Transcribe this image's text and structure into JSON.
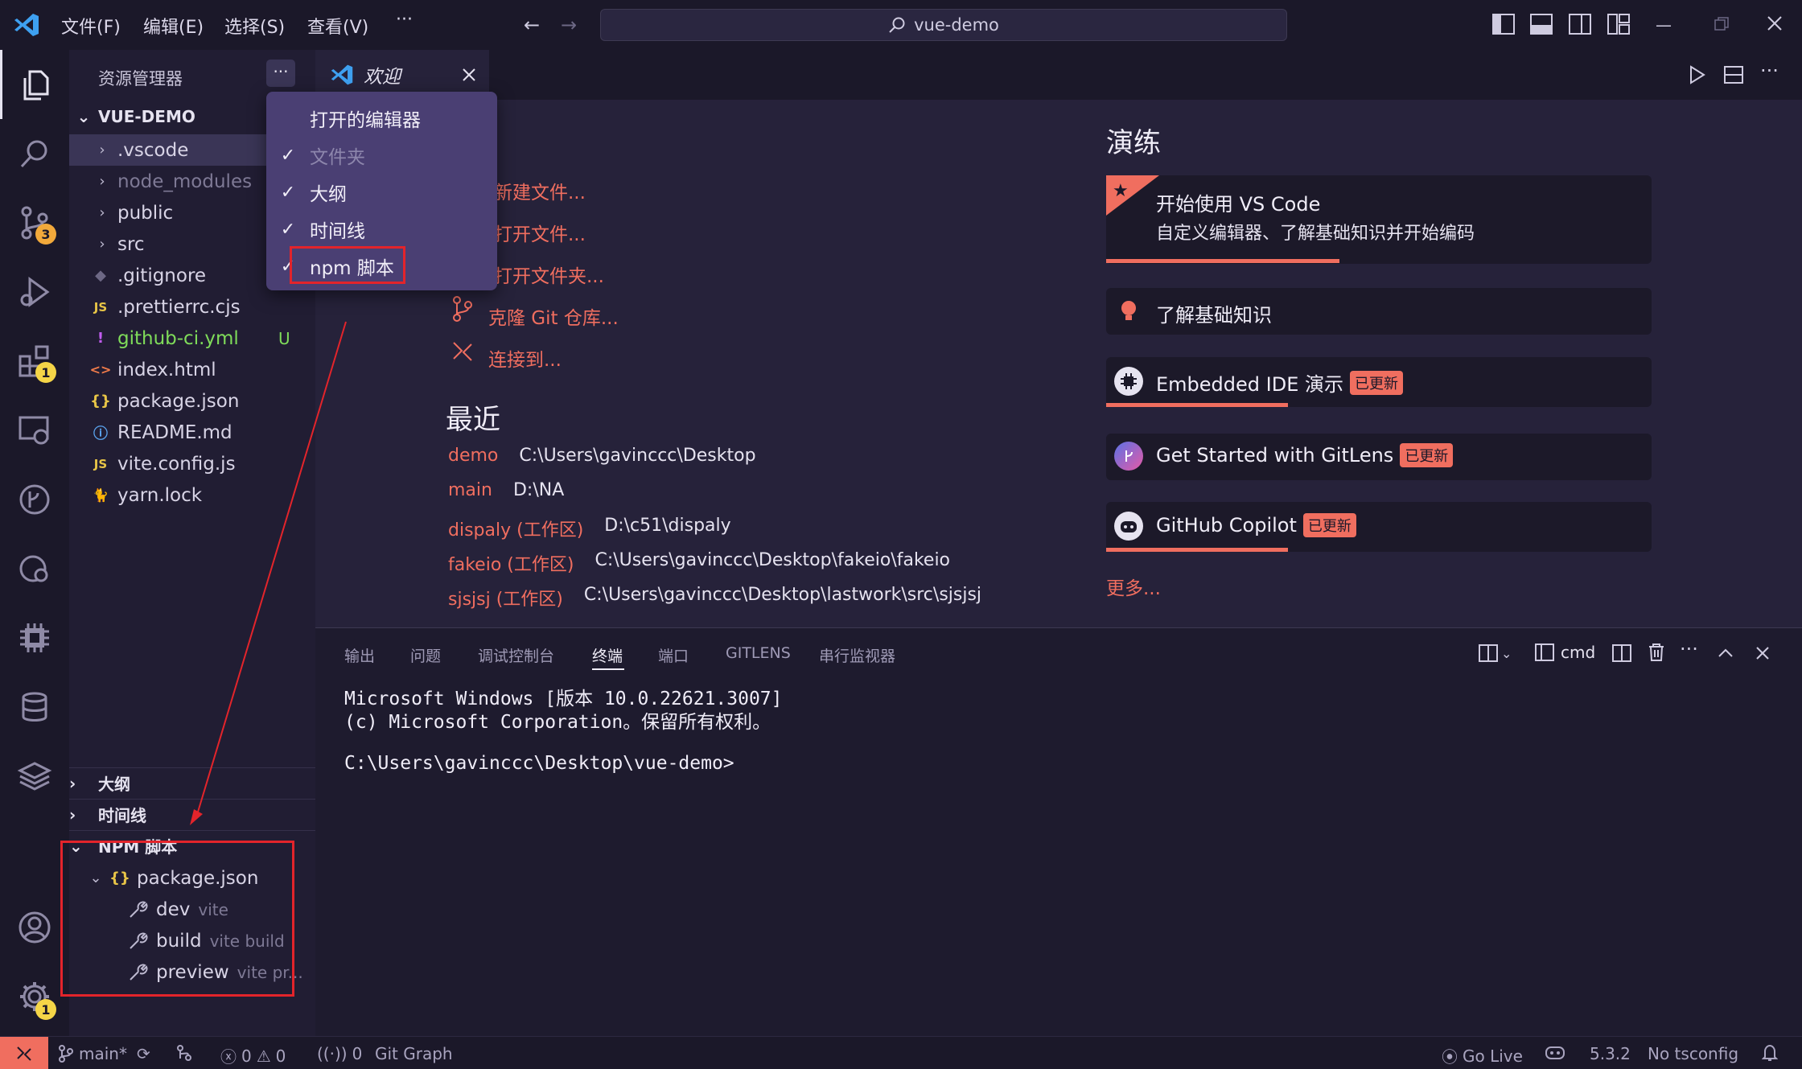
{
  "titlebar": {
    "menus": [
      "文件(F)",
      "编辑(E)",
      "选择(S)",
      "查看(V)"
    ],
    "more": "···",
    "search": "vue-demo"
  },
  "activity": {
    "scm_badge": "3",
    "extensions_badge": "1",
    "settings_badge": "1"
  },
  "sidebar": {
    "title": "资源管理器",
    "more": "···",
    "root": "VUE-DEMO",
    "items": [
      {
        "label": ".vscode",
        "type": "folder"
      },
      {
        "label": "node_modules",
        "type": "folder"
      },
      {
        "label": "public",
        "type": "folder"
      },
      {
        "label": "src",
        "type": "folder"
      },
      {
        "label": ".gitignore",
        "type": "file",
        "icon": "◆"
      },
      {
        "label": ".prettierrc.cjs",
        "type": "file",
        "icon": "JS"
      },
      {
        "label": "github-ci.yml",
        "type": "file",
        "icon": "!",
        "status": "U"
      },
      {
        "label": "index.html",
        "type": "file",
        "icon": "<>"
      },
      {
        "label": "package.json",
        "type": "file",
        "icon": "{}"
      },
      {
        "label": "README.md",
        "type": "file",
        "icon": "ⓘ"
      },
      {
        "label": "vite.config.js",
        "type": "file",
        "icon": "JS"
      },
      {
        "label": "yarn.lock",
        "type": "file",
        "icon": "🐈"
      }
    ],
    "outline": "大纲",
    "timeline": "时间线",
    "npm": {
      "header": "NPM 脚本",
      "package": "package.json",
      "scripts": [
        {
          "name": "dev",
          "cmd": "vite"
        },
        {
          "name": "build",
          "cmd": "vite build"
        },
        {
          "name": "preview",
          "cmd": "vite pr..."
        }
      ]
    }
  },
  "context_menu": {
    "items": [
      {
        "label": "打开的编辑器",
        "checked": false,
        "dim": false
      },
      {
        "label": "文件夹",
        "checked": true,
        "dim": true
      },
      {
        "label": "大纲",
        "checked": true,
        "dim": false
      },
      {
        "label": "时间线",
        "checked": true,
        "dim": false
      },
      {
        "label": "npm 脚本",
        "checked": true,
        "dim": false
      }
    ]
  },
  "tabs": {
    "welcome": "欢迎"
  },
  "welcome": {
    "start_links": [
      "新建文件...",
      "打开文件...",
      "打开文件夹...",
      "克隆 Git 仓库...",
      "连接到..."
    ],
    "recent_title": "最近",
    "recent": [
      {
        "name": "demo",
        "path": "C:\\Users\\gavinccc\\Desktop"
      },
      {
        "name": "main",
        "path": "D:\\NA"
      },
      {
        "name": "dispaly (工作区)",
        "path": "D:\\c51\\dispaly"
      },
      {
        "name": "fakeio (工作区)",
        "path": "C:\\Users\\gavinccc\\Desktop\\fakeio\\fakeio"
      },
      {
        "name": "sjsjsj (工作区)",
        "path": "C:\\Users\\gavinccc\\Desktop\\lastwork\\src\\sjsjsj"
      }
    ],
    "walkthrough_title": "演练",
    "cards": [
      {
        "title": "开始使用 VS Code",
        "desc": "自定义编辑器、了解基础知识并开始编码",
        "progress": 0.42
      },
      {
        "title": "了解基础知识",
        "progress": 0
      },
      {
        "title": "Embedded IDE 演示",
        "tag": "已更新",
        "progress": 0.33
      },
      {
        "title": "Get Started with GitLens",
        "tag": "已更新",
        "progress": 0
      },
      {
        "title": "GitHub Copilot",
        "tag": "已更新",
        "progress": 0.33
      }
    ],
    "more": "更多..."
  },
  "panel": {
    "tabs": [
      "输出",
      "问题",
      "调试控制台",
      "终端",
      "端口",
      "GITLENS",
      "串行监视器"
    ],
    "active_tab": "终端",
    "shell": "cmd",
    "terminal_lines": [
      "Microsoft Windows [版本 10.0.22621.3007]",
      "(c) Microsoft Corporation。保留所有权利。",
      "",
      "C:\\Users\\gavinccc\\Desktop\\vue-demo>"
    ]
  },
  "statusbar": {
    "branch": "main*",
    "errors": "0",
    "warnings": "0",
    "ports": "0",
    "git_graph": "Git Graph",
    "go_live": "Go Live",
    "version": "5.3.2",
    "tsconfig": "No tsconfig"
  },
  "colors": {
    "accent": "#f06e5f",
    "highlight_box": "#e3242b",
    "menu_bg": "#4a3f73"
  }
}
